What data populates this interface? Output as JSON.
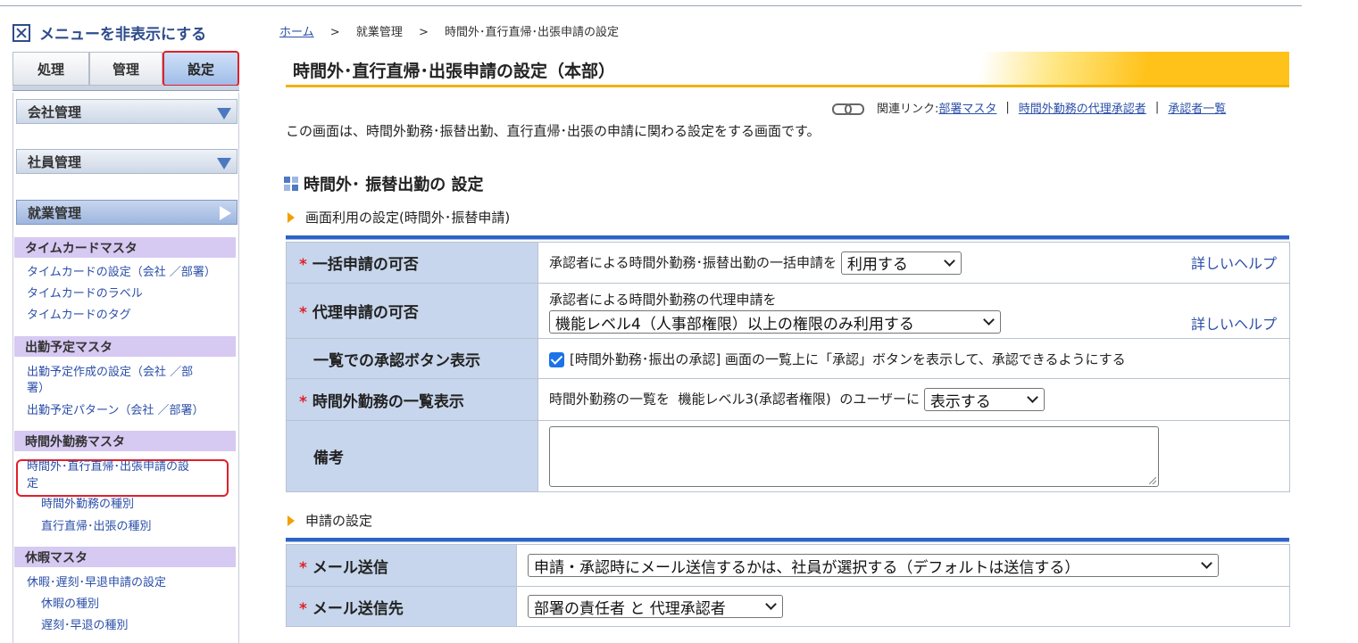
{
  "sidebar": {
    "hide_menu": "メニューを非表示にする",
    "tabs": [
      "処理",
      "管理",
      "設定"
    ],
    "sections": [
      "会社管理",
      "社員管理",
      "就業管理"
    ],
    "categories": {
      "timecard": "タイムカードマスタ",
      "schedule": "出勤予定マスタ",
      "overtime": "時間外勤務マスタ",
      "leave": "休暇マスタ"
    },
    "links": {
      "tc_setting": "タイムカードの設定（会社 ／部署）",
      "tc_label": "タイムカードのラベル",
      "tc_tag": "タイムカードのタグ",
      "sch_create_1": "出勤予定作成の設定（会社 ／部",
      "sch_create_2": "署）",
      "sch_pattern": "出勤予定パターン（会社 ／部署）",
      "ot_setting_1": "時間外･直行直帰･出張申請の設",
      "ot_setting_2": "定",
      "ot_type": "時間外勤務の種別",
      "direct_type": "直行直帰･出張の種別",
      "leave_setting": "休暇･遅刻･早退申請の設定",
      "leave_type": "休暇の種別",
      "late_type": "遅刻･早退の種別"
    }
  },
  "breadcrumb": {
    "home": "ホーム",
    "sep": ">",
    "level2": "就業管理",
    "current": "時間外･直行直帰･出張申請の設定"
  },
  "page_title": "時間外･直行直帰･出張申請の設定（本部）",
  "related": {
    "label": "関連リンク:",
    "links": [
      "部署マスタ",
      "時間外勤務の代理承認者",
      "承認者一覧"
    ],
    "sep": "|"
  },
  "description": "この画面は、時間外勤務･振替出勤、直行直帰･出張の申請に関わる設定をする画面です。",
  "section1": {
    "title": "時間外･ 振替出勤の 設定",
    "subheading": "画面利用の設定(時間外･振替申請)",
    "rows": {
      "bulk": {
        "required_mark": "*",
        "label": "一括申請の可否",
        "text": "承認者による時間外勤務･振替出勤の一括申請を",
        "select": "利用する",
        "help": "詳しいヘルプ"
      },
      "proxy": {
        "required_mark": "*",
        "label": "代理申請の可否",
        "text": "承認者による時間外勤務の代理申請を",
        "select": "機能レベル4（人事部権限）以上の権限のみ利用する",
        "help": "詳しいヘルプ"
      },
      "approve_btn": {
        "label": "一覧での承認ボタン表示",
        "checkbox_label": "[時間外勤務･振出の承認] 画面の一覧上に「承認」ボタンを表示して、承認できるようにする"
      },
      "list_display": {
        "required_mark": "*",
        "label": "時間外勤務の一覧表示",
        "text": "時間外勤務の一覧を  機能レベル3(承認者権限)  のユーザーに",
        "select": "表示する"
      },
      "note": {
        "label": "備考"
      }
    }
  },
  "section2": {
    "subheading": "申請の設定",
    "rows": {
      "mail": {
        "required_mark": "*",
        "label": "メール送信",
        "select": "申請・承認時にメール送信するかは、社員が選択する（デフォルトは送信する）"
      },
      "mail_to": {
        "required_mark": "*",
        "label": "メール送信先",
        "select": "部署の責任者 と 代理承認者"
      }
    }
  }
}
